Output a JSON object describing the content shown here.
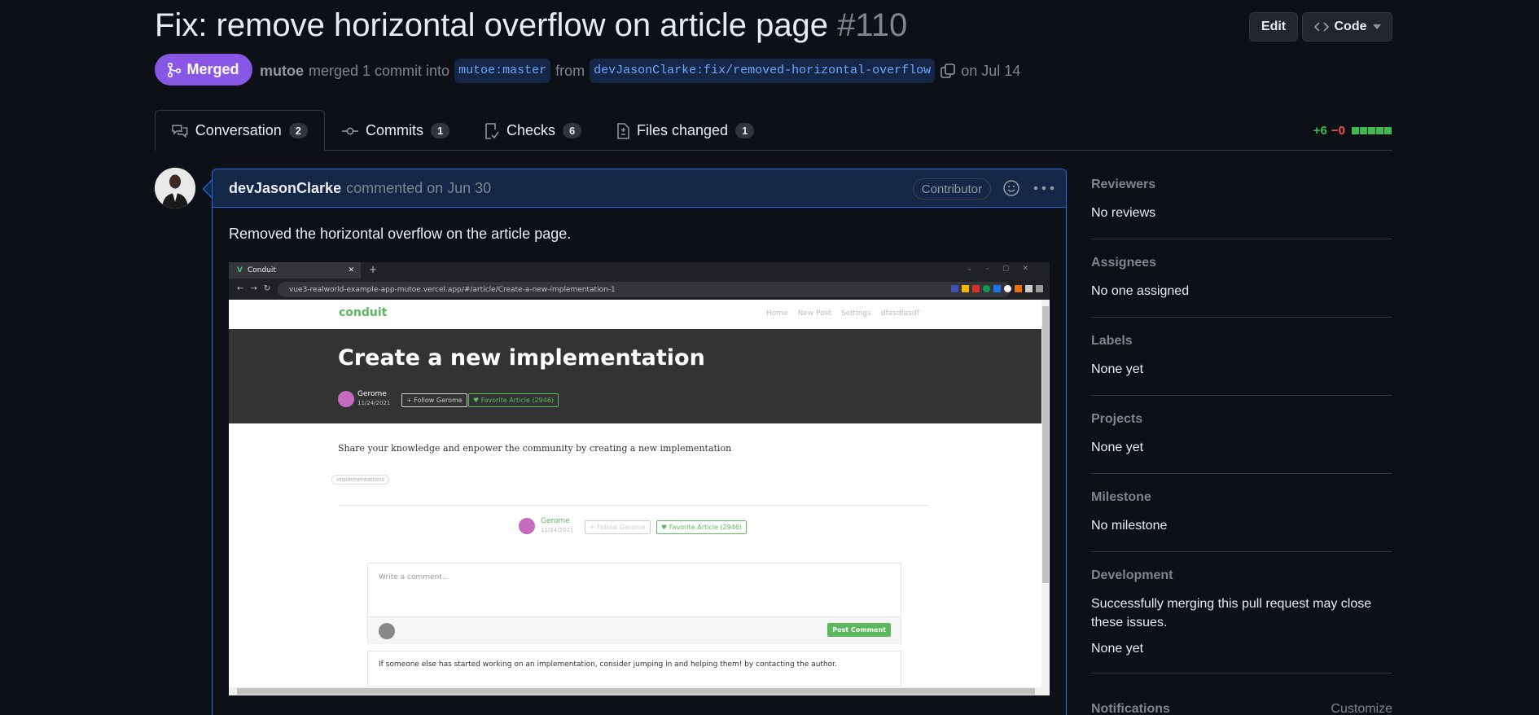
{
  "header": {
    "title": "Fix: remove horizontal overflow on article page",
    "number": "#110",
    "edit_label": "Edit",
    "code_label": "Code"
  },
  "status": {
    "state": "Merged",
    "author": "mutoe",
    "action": "merged 1 commit into",
    "base_branch": "mutoe:master",
    "from_label": "from",
    "head_branch": "devJasonClarke:fix/removed-horizontal-overflow",
    "date": "on Jul 14"
  },
  "tabs": [
    {
      "label": "Conversation",
      "count": "2"
    },
    {
      "label": "Commits",
      "count": "1"
    },
    {
      "label": "Checks",
      "count": "6"
    },
    {
      "label": "Files changed",
      "count": "1"
    }
  ],
  "diffstat": {
    "additions": "+6",
    "deletions": "−0"
  },
  "comment": {
    "author": "devJasonClarke",
    "meta": "commented on Jun 30",
    "role": "Contributor",
    "body": "Removed the horizontal overflow on the article page."
  },
  "screenshot": {
    "tab_title": "Conduit",
    "url": "vue3-realworld-example-app-mutoe.vercel.app/#/article/Create-a-new-implementation-1",
    "logo": "conduit",
    "nav": [
      "Home",
      "New Post",
      "Settings",
      "dfasdfasdf"
    ],
    "article_title": "Create a new implementation",
    "author": "Gerome",
    "date": "11/24/2021",
    "follow": "Follow Gerome",
    "favorite": "Favorite Article (2946)",
    "body": "Share your knowledge and enpower the community by creating a new implementation",
    "tag": "implementations",
    "comment_placeholder": "Write a comment...",
    "post_comment": "Post Comment",
    "comment_text": "If someone else has started working on an implementation, consider jumping in and helping them! by contacting the author."
  },
  "sidebar": {
    "reviewers": {
      "heading": "Reviewers",
      "value": "No reviews"
    },
    "assignees": {
      "heading": "Assignees",
      "value": "No one assigned"
    },
    "labels": {
      "heading": "Labels",
      "value": "None yet"
    },
    "projects": {
      "heading": "Projects",
      "value": "None yet"
    },
    "milestone": {
      "heading": "Milestone",
      "value": "No milestone"
    },
    "development": {
      "heading": "Development",
      "value": "Successfully merging this pull request may close these issues.",
      "sub": "None yet"
    },
    "notifications": {
      "heading": "Notifications",
      "action": "Customize"
    }
  },
  "colors": {
    "merged": "#8957e5",
    "accent": "#1f6feb",
    "add": "#3fb950",
    "del": "#f85149",
    "conduit_green": "#5cb85c"
  }
}
